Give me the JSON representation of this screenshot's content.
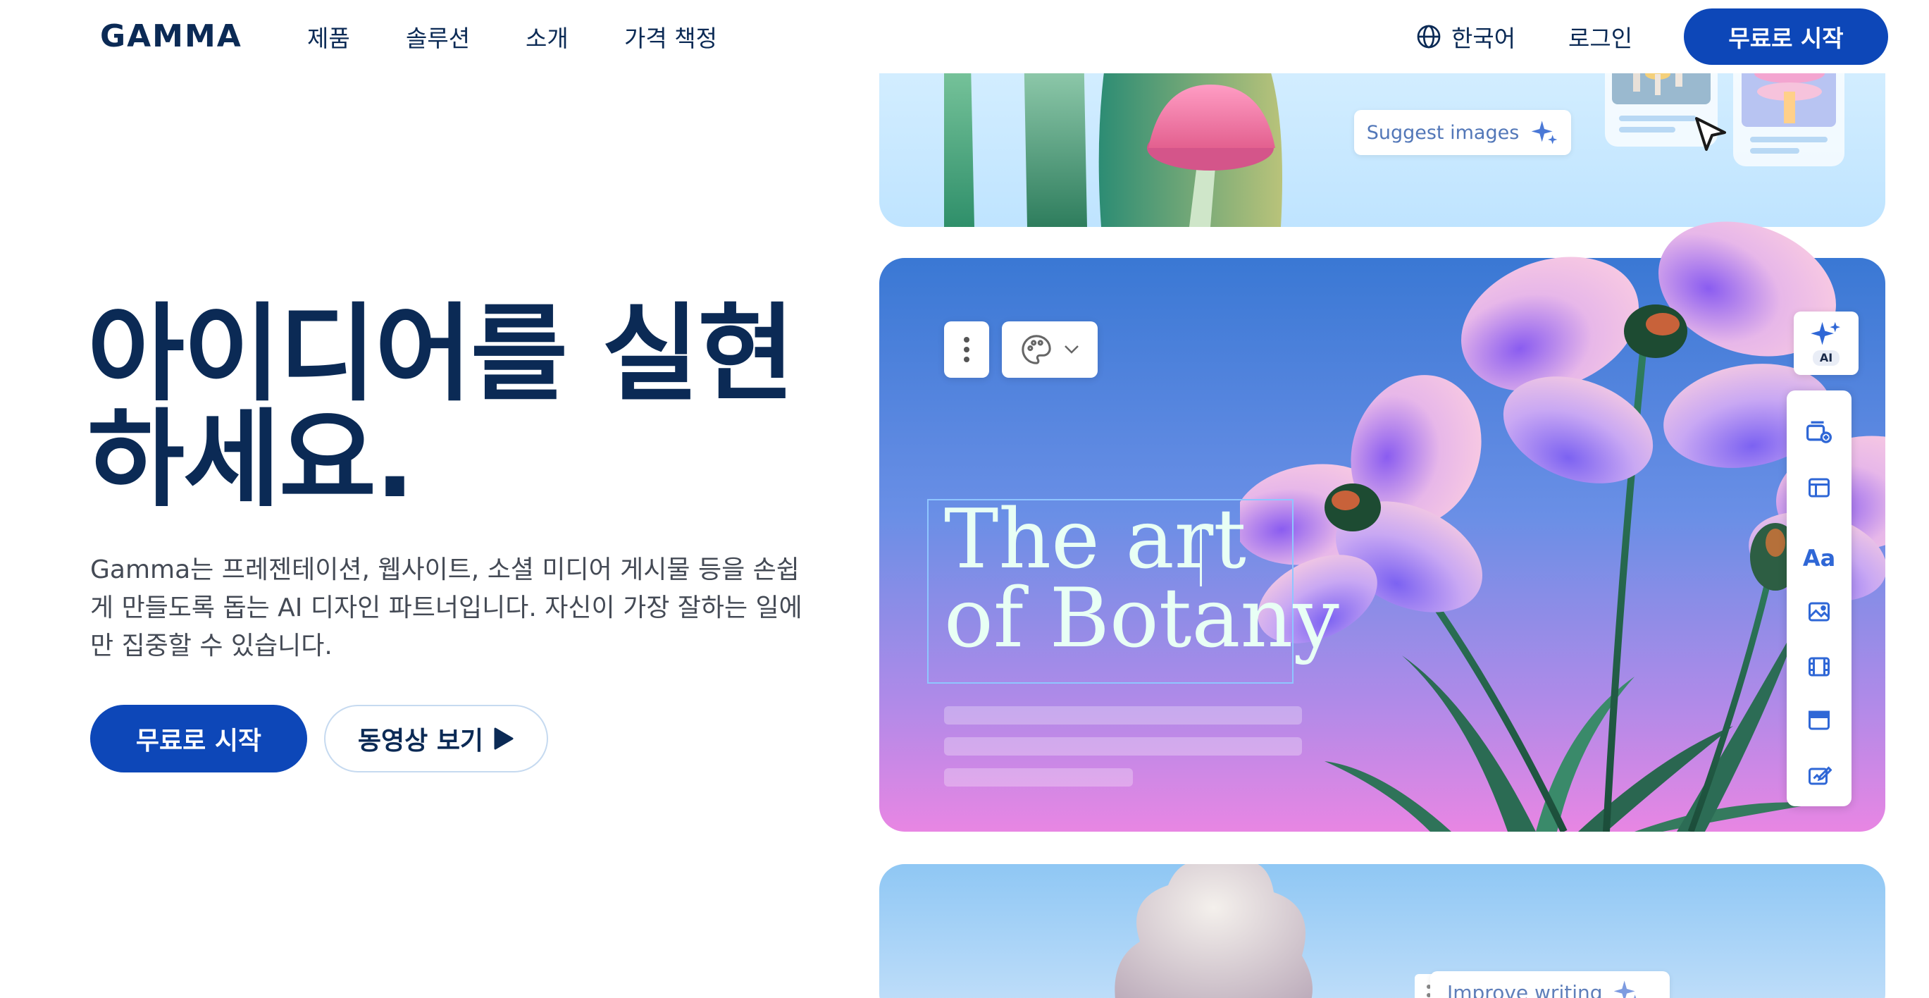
{
  "nav": {
    "logo": "GAMMA",
    "links": [
      "제품",
      "솔루션",
      "소개",
      "가격 책정"
    ],
    "language": "한국어",
    "login": "로그인",
    "cta": "무료로 시작"
  },
  "hero": {
    "title_line1": "아이디어를 실현",
    "title_line2": "하세요.",
    "subtitle": "Gamma는 프레젠테이션, 웹사이트, 소셜 미디어 게시물 등을 손쉽게 만들도록 돕는 AI 디자인 파트너입니다. 자신이 가장 잘하는 일에만 집중할 수 있습니다.",
    "cta": "무료로 시작",
    "video": "동영상 보기"
  },
  "showcase": {
    "suggest_label": "Suggest images",
    "title_line1": "The art",
    "title_line2": "of Botany",
    "ai_badge": "AI",
    "improve_label": "Improve writing",
    "side_tools": [
      "add-card-icon",
      "layout-icon",
      "text-icon",
      "image-icon",
      "video-icon",
      "embed-icon",
      "form-icon"
    ]
  },
  "colors": {
    "brand": "#0d47b8",
    "text_dark": "#0b2a55"
  }
}
